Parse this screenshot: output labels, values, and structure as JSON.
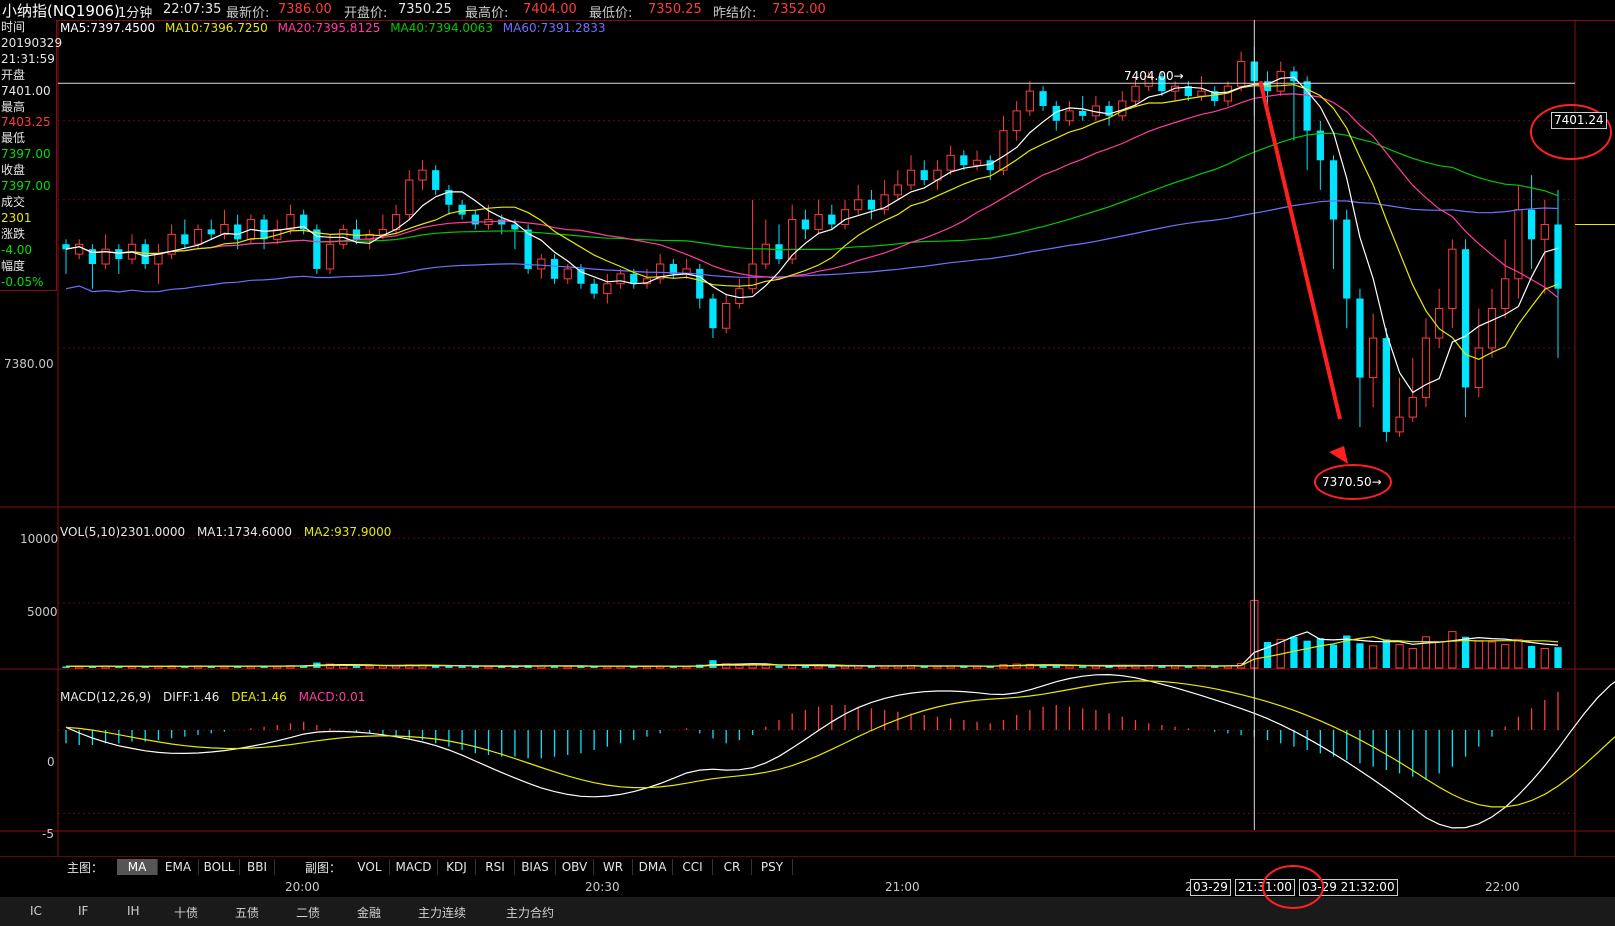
{
  "topbar": {
    "title": "小纳指(NQ1906)",
    "period": "1分钟",
    "time": "22:07:35",
    "latest_label": "最新价:",
    "latest_value": "7386.00",
    "open_label": "开盘价:",
    "open_value": "7350.25",
    "high_label": "最高价:",
    "high_value": "7404.00",
    "low_label": "最低价:",
    "low_value": "7350.25",
    "prev_label": "昨结价:",
    "prev_value": "7352.00"
  },
  "info_panel": {
    "time_label": "时间",
    "date": "20190329",
    "time": "21:31:59",
    "open_label": "开盘",
    "open": "7401.00",
    "high_label": "最高",
    "high": "7403.25",
    "low_label": "最低",
    "low": "7397.00",
    "close_label": "收盘",
    "close": "7397.00",
    "volume_label": "成交",
    "volume": "2301",
    "change_label": "涨跌",
    "change": "-4.00",
    "amplitude_label": "幅度",
    "amplitude": "-0.05%"
  },
  "ma_legend": {
    "ma5": "MA5:7397.4500",
    "ma10": "MA10:7396.7250",
    "ma20": "MA20:7395.8125",
    "ma40": "MA40:7394.0063",
    "ma60": "MA60:7391.2833"
  },
  "vol_legend": {
    "vol": "VOL(5,10)2301.0000",
    "ma1": "MA1:1734.6000",
    "ma2": "MA2:937.9000"
  },
  "macd_legend": {
    "macd": "MACD(12,26,9)",
    "diff": "DIFF:1.46",
    "dea": "DEA:1.46",
    "macd_val": "MACD:0.01"
  },
  "annotations": {
    "high_marker": "7404.00",
    "low_marker": "7370.50",
    "cursor_price": "7401.24",
    "cursor_time_left": "03-29",
    "cursor_time_mid": "21:31:00",
    "cursor_time_right": "03-29 21:32:00"
  },
  "y_axis": {
    "price_tick": "7380.00",
    "vol_ticks": [
      "10000",
      "5000"
    ],
    "macd_ticks": [
      "0",
      "-5"
    ]
  },
  "tabs": {
    "main_label": "主图：",
    "main": [
      "MA",
      "EMA",
      "BOLL",
      "BBI"
    ],
    "sub_label": "副图：",
    "sub": [
      "VOL",
      "MACD",
      "KDJ",
      "RSI",
      "BIAS",
      "OBV",
      "WR",
      "DMA",
      "CCI",
      "CR",
      "PSY"
    ]
  },
  "time_axis": [
    "20:00",
    "20:30",
    "21:00",
    "2",
    "22:00"
  ],
  "bottom_bar": [
    "IC",
    "IF",
    "IH",
    "十债",
    "五债",
    "二债",
    "金融",
    "主力连续",
    "主力合约"
  ],
  "colors": {
    "up": "#ff3b3b",
    "down": "#00e5ff",
    "ma5": "#ffffff",
    "ma10": "#e8e800",
    "ma20": "#ff3ca0",
    "ma40": "#00c800",
    "ma60": "#7070ff",
    "annotation": "#ff2020"
  },
  "chart_data": {
    "type": "candlestick",
    "symbol": "小纳指(NQ1906)",
    "period": "1分钟",
    "price_ylim": [
      7364,
      7413
    ],
    "price_tick_labels": [
      "7380.00"
    ],
    "vol_ylim": [
      0,
      11000
    ],
    "macd_ylim": [
      -6,
      3
    ],
    "x_ticks": [
      "20:00",
      "20:30",
      "21:00",
      "2",
      "22:00"
    ],
    "candles": [
      [
        7390.5,
        7390.0,
        7391.0,
        7387.5
      ],
      [
        7389.5,
        7390.5,
        7391.0,
        7389.0
      ],
      [
        7390.0,
        7388.5,
        7390.5,
        7386.0
      ],
      [
        7388.5,
        7390.0,
        7391.5,
        7388.0
      ],
      [
        7390.0,
        7389.0,
        7390.5,
        7387.5
      ],
      [
        7389.0,
        7390.5,
        7391.5,
        7388.5
      ],
      [
        7390.5,
        7388.5,
        7391.0,
        7388.0
      ],
      [
        7388.5,
        7389.5,
        7390.5,
        7386.5
      ],
      [
        7389.5,
        7391.5,
        7392.5,
        7389.0
      ],
      [
        7391.5,
        7390.5,
        7393.0,
        7390.0
      ],
      [
        7390.5,
        7392.0,
        7392.5,
        7390.0
      ],
      [
        7392.0,
        7391.5,
        7393.0,
        7391.0
      ],
      [
        7391.5,
        7392.5,
        7394.0,
        7391.0
      ],
      [
        7392.5,
        7391.0,
        7393.5,
        7390.0
      ],
      [
        7391.0,
        7393.0,
        7393.5,
        7390.5
      ],
      [
        7393.0,
        7391.0,
        7393.5,
        7390.0
      ],
      [
        7391.0,
        7392.0,
        7393.0,
        7390.5
      ],
      [
        7392.0,
        7393.5,
        7394.5,
        7391.5
      ],
      [
        7393.5,
        7392.0,
        7394.0,
        7391.5
      ],
      [
        7392.0,
        7388.0,
        7392.5,
        7387.5
      ],
      [
        7388.0,
        7390.5,
        7391.5,
        7387.5
      ],
      [
        7390.5,
        7392.0,
        7392.5,
        7390.0
      ],
      [
        7392.0,
        7391.0,
        7393.0,
        7390.5
      ],
      [
        7391.0,
        7391.5,
        7392.0,
        7390.0
      ],
      [
        7391.5,
        7392.0,
        7393.5,
        7391.0
      ],
      [
        7392.0,
        7393.5,
        7394.5,
        7391.5
      ],
      [
        7393.5,
        7397.0,
        7398.0,
        7393.0
      ],
      [
        7397.0,
        7398.0,
        7399.0,
        7396.0
      ],
      [
        7398.0,
        7396.0,
        7398.5,
        7395.5
      ],
      [
        7396.0,
        7394.5,
        7396.5,
        7393.5
      ],
      [
        7394.5,
        7393.5,
        7395.0,
        7393.0
      ],
      [
        7393.5,
        7392.5,
        7394.0,
        7392.0
      ],
      [
        7392.5,
        7393.0,
        7394.5,
        7392.0
      ],
      [
        7393.0,
        7392.5,
        7393.5,
        7391.5
      ],
      [
        7392.5,
        7392.0,
        7393.0,
        7390.0
      ],
      [
        7392.0,
        7388.0,
        7392.5,
        7387.5
      ],
      [
        7388.0,
        7389.0,
        7389.5,
        7387.0
      ],
      [
        7389.0,
        7387.0,
        7389.5,
        7386.5
      ],
      [
        7387.0,
        7388.0,
        7388.5,
        7386.5
      ],
      [
        7388.0,
        7386.5,
        7388.5,
        7386.0
      ],
      [
        7386.5,
        7385.5,
        7387.0,
        7385.0
      ],
      [
        7385.5,
        7386.5,
        7387.5,
        7384.5
      ],
      [
        7386.5,
        7387.5,
        7388.0,
        7386.0
      ],
      [
        7387.5,
        7386.5,
        7388.0,
        7386.0
      ],
      [
        7386.5,
        7387.0,
        7388.0,
        7386.0
      ],
      [
        7387.0,
        7388.5,
        7389.5,
        7386.5
      ],
      [
        7388.5,
        7387.5,
        7389.0,
        7387.0
      ],
      [
        7387.5,
        7388.0,
        7389.0,
        7387.0
      ],
      [
        7388.0,
        7385.0,
        7388.5,
        7384.0
      ],
      [
        7385.0,
        7382.0,
        7385.5,
        7381.0
      ],
      [
        7382.0,
        7384.5,
        7385.5,
        7381.5
      ],
      [
        7384.5,
        7386.0,
        7387.0,
        7384.0
      ],
      [
        7386.0,
        7388.5,
        7395.0,
        7385.5
      ],
      [
        7388.5,
        7390.5,
        7393.0,
        7388.0
      ],
      [
        7390.5,
        7389.0,
        7392.5,
        7388.5
      ],
      [
        7389.0,
        7393.0,
        7394.5,
        7388.5
      ],
      [
        7393.0,
        7392.0,
        7394.0,
        7391.0
      ],
      [
        7392.0,
        7393.5,
        7395.0,
        7391.5
      ],
      [
        7393.5,
        7392.5,
        7394.5,
        7392.0
      ],
      [
        7392.5,
        7394.0,
        7395.0,
        7392.0
      ],
      [
        7394.0,
        7395.0,
        7396.5,
        7393.5
      ],
      [
        7395.0,
        7394.0,
        7396.0,
        7393.0
      ],
      [
        7394.0,
        7395.5,
        7397.0,
        7393.5
      ],
      [
        7395.5,
        7396.5,
        7398.0,
        7395.0
      ],
      [
        7396.5,
        7398.0,
        7399.5,
        7396.0
      ],
      [
        7398.0,
        7397.0,
        7399.0,
        7396.5
      ],
      [
        7397.0,
        7398.0,
        7399.0,
        7396.0
      ],
      [
        7398.0,
        7399.5,
        7400.5,
        7397.5
      ],
      [
        7399.5,
        7398.5,
        7400.0,
        7398.0
      ],
      [
        7398.5,
        7399.0,
        7400.0,
        7398.0
      ],
      [
        7399.0,
        7398.0,
        7399.5,
        7397.0
      ],
      [
        7398.0,
        7402.0,
        7403.5,
        7397.5
      ],
      [
        7402.0,
        7404.0,
        7405.0,
        7401.0
      ],
      [
        7404.0,
        7406.0,
        7407.0,
        7403.5
      ],
      [
        7406.0,
        7404.5,
        7406.5,
        7404.0
      ],
      [
        7404.5,
        7403.0,
        7405.0,
        7402.0
      ],
      [
        7403.0,
        7404.0,
        7405.0,
        7402.5
      ],
      [
        7404.0,
        7403.5,
        7405.5,
        7403.0
      ],
      [
        7403.5,
        7404.5,
        7405.5,
        7403.0
      ],
      [
        7404.5,
        7403.5,
        7405.0,
        7402.5
      ],
      [
        7403.5,
        7405.0,
        7406.0,
        7403.0
      ],
      [
        7405.0,
        7406.5,
        7407.5,
        7404.5
      ],
      [
        7406.5,
        7407.5,
        7408.0,
        7406.0
      ],
      [
        7407.5,
        7406.0,
        7408.0,
        7405.5
      ],
      [
        7406.0,
        7406.5,
        7407.0,
        7405.0
      ],
      [
        7406.5,
        7405.5,
        7407.0,
        7405.0
      ],
      [
        7405.5,
        7406.0,
        7407.5,
        7405.0
      ],
      [
        7406.0,
        7405.0,
        7406.5,
        7404.5
      ],
      [
        7405.0,
        7406.5,
        7407.0,
        7404.5
      ],
      [
        7406.5,
        7409.0,
        7410.0,
        7406.0
      ],
      [
        7409.0,
        7407.0,
        7410.5,
        7403.5
      ],
      [
        7407.0,
        7406.0,
        7408.0,
        7404.5
      ],
      [
        7406.0,
        7408.0,
        7409.0,
        7405.5
      ],
      [
        7408.0,
        7407.0,
        7408.5,
        7401.0
      ],
      [
        7407.0,
        7402.0,
        7407.5,
        7398.0
      ],
      [
        7402.0,
        7399.0,
        7403.0,
        7396.0
      ],
      [
        7399.0,
        7393.0,
        7399.5,
        7388.0
      ],
      [
        7393.0,
        7385.0,
        7394.0,
        7382.0
      ],
      [
        7385.0,
        7377.0,
        7386.0,
        7372.0
      ],
      [
        7377.0,
        7381.0,
        7383.5,
        7374.0
      ],
      [
        7381.0,
        7371.5,
        7382.0,
        7370.5
      ],
      [
        7371.5,
        7373.0,
        7377.0,
        7371.0
      ],
      [
        7373.0,
        7375.0,
        7379.0,
        7372.5
      ],
      [
        7375.0,
        7381.0,
        7383.0,
        7374.0
      ],
      [
        7381.0,
        7384.0,
        7386.0,
        7380.0
      ],
      [
        7384.0,
        7390.0,
        7391.0,
        7382.0
      ],
      [
        7390.0,
        7376.0,
        7391.0,
        7373.0
      ],
      [
        7376.0,
        7380.0,
        7384.0,
        7375.0
      ],
      [
        7380.0,
        7384.0,
        7386.0,
        7379.0
      ],
      [
        7384.0,
        7387.0,
        7391.0,
        7383.0
      ],
      [
        7387.0,
        7394.0,
        7396.5,
        7385.0
      ],
      [
        7394.0,
        7391.0,
        7397.5,
        7388.0
      ],
      [
        7391.0,
        7392.5,
        7395.0,
        7385.5
      ],
      [
        7392.5,
        7386.0,
        7396.0,
        7379.0
      ]
    ],
    "volumes": [
      [
        120,
        "d"
      ],
      [
        150,
        "u"
      ],
      [
        130,
        "d"
      ],
      [
        140,
        "u"
      ],
      [
        110,
        "d"
      ],
      [
        120,
        "u"
      ],
      [
        100,
        "d"
      ],
      [
        130,
        "u"
      ],
      [
        160,
        "u"
      ],
      [
        140,
        "d"
      ],
      [
        150,
        "u"
      ],
      [
        120,
        "d"
      ],
      [
        140,
        "u"
      ],
      [
        160,
        "d"
      ],
      [
        130,
        "u"
      ],
      [
        150,
        "d"
      ],
      [
        130,
        "u"
      ],
      [
        180,
        "u"
      ],
      [
        200,
        "d"
      ],
      [
        420,
        "d"
      ],
      [
        300,
        "u"
      ],
      [
        200,
        "u"
      ],
      [
        160,
        "d"
      ],
      [
        140,
        "u"
      ],
      [
        160,
        "u"
      ],
      [
        180,
        "u"
      ],
      [
        240,
        "u"
      ],
      [
        200,
        "u"
      ],
      [
        160,
        "d"
      ],
      [
        150,
        "d"
      ],
      [
        130,
        "d"
      ],
      [
        140,
        "d"
      ],
      [
        130,
        "u"
      ],
      [
        120,
        "d"
      ],
      [
        130,
        "d"
      ],
      [
        220,
        "d"
      ],
      [
        160,
        "u"
      ],
      [
        170,
        "d"
      ],
      [
        130,
        "u"
      ],
      [
        140,
        "d"
      ],
      [
        120,
        "d"
      ],
      [
        140,
        "u"
      ],
      [
        150,
        "u"
      ],
      [
        120,
        "d"
      ],
      [
        130,
        "u"
      ],
      [
        150,
        "u"
      ],
      [
        130,
        "d"
      ],
      [
        120,
        "u"
      ],
      [
        260,
        "d"
      ],
      [
        600,
        "d"
      ],
      [
        320,
        "u"
      ],
      [
        200,
        "u"
      ],
      [
        260,
        "u"
      ],
      [
        200,
        "u"
      ],
      [
        180,
        "d"
      ],
      [
        200,
        "u"
      ],
      [
        160,
        "d"
      ],
      [
        160,
        "u"
      ],
      [
        150,
        "d"
      ],
      [
        150,
        "u"
      ],
      [
        170,
        "u"
      ],
      [
        140,
        "d"
      ],
      [
        150,
        "u"
      ],
      [
        160,
        "u"
      ],
      [
        180,
        "u"
      ],
      [
        150,
        "d"
      ],
      [
        130,
        "u"
      ],
      [
        160,
        "u"
      ],
      [
        130,
        "d"
      ],
      [
        140,
        "u"
      ],
      [
        140,
        "d"
      ],
      [
        260,
        "u"
      ],
      [
        300,
        "u"
      ],
      [
        280,
        "u"
      ],
      [
        200,
        "d"
      ],
      [
        180,
        "d"
      ],
      [
        160,
        "u"
      ],
      [
        150,
        "d"
      ],
      [
        150,
        "u"
      ],
      [
        140,
        "d"
      ],
      [
        170,
        "u"
      ],
      [
        200,
        "u"
      ],
      [
        200,
        "u"
      ],
      [
        160,
        "d"
      ],
      [
        150,
        "u"
      ],
      [
        140,
        "d"
      ],
      [
        160,
        "u"
      ],
      [
        140,
        "d"
      ],
      [
        160,
        "u"
      ],
      [
        350,
        "u"
      ],
      [
        5200,
        "u"
      ],
      [
        2000,
        "d"
      ],
      [
        2200,
        "u"
      ],
      [
        2400,
        "d"
      ],
      [
        2100,
        "d"
      ],
      [
        2300,
        "d"
      ],
      [
        1800,
        "d"
      ],
      [
        2500,
        "d"
      ],
      [
        1900,
        "d"
      ],
      [
        1700,
        "u"
      ],
      [
        2200,
        "d"
      ],
      [
        1800,
        "u"
      ],
      [
        1500,
        "u"
      ],
      [
        2400,
        "u"
      ],
      [
        2000,
        "u"
      ],
      [
        2800,
        "u"
      ],
      [
        2400,
        "d"
      ],
      [
        2100,
        "u"
      ],
      [
        2000,
        "u"
      ],
      [
        1800,
        "u"
      ],
      [
        2200,
        "u"
      ],
      [
        1700,
        "d"
      ],
      [
        1500,
        "u"
      ],
      [
        1600,
        "d"
      ]
    ],
    "macd_hist": [
      -0.8,
      -0.9,
      -0.9,
      -0.8,
      -0.8,
      -0.7,
      -0.7,
      -0.6,
      -0.5,
      -0.4,
      -0.3,
      -0.2,
      -0.1,
      0.0,
      0.1,
      0.2,
      0.3,
      0.4,
      0.5,
      0.3,
      0.1,
      0.0,
      -0.1,
      -0.2,
      -0.3,
      -0.4,
      -0.5,
      -0.6,
      -0.8,
      -1.0,
      -1.2,
      -1.4,
      -1.5,
      -1.6,
      -1.6,
      -1.7,
      -1.7,
      -1.6,
      -1.5,
      -1.4,
      -1.2,
      -1.0,
      -0.8,
      -0.6,
      -0.4,
      -0.2,
      0.0,
      0.1,
      -0.2,
      -0.5,
      -0.8,
      -0.6,
      -0.3,
      0.2,
      0.6,
      1.0,
      1.2,
      1.4,
      1.5,
      1.5,
      1.4,
      1.3,
      1.2,
      1.1,
      1.0,
      0.9,
      0.8,
      0.7,
      0.6,
      0.5,
      0.4,
      0.6,
      0.9,
      1.2,
      1.4,
      1.5,
      1.4,
      1.3,
      1.2,
      1.0,
      0.8,
      0.6,
      0.4,
      0.3,
      0.2,
      0.1,
      0.0,
      -0.1,
      -0.2,
      -0.3,
      -0.4,
      -0.6,
      -0.8,
      -1.0,
      -1.2,
      -1.4,
      -1.6,
      -1.8,
      -2.0,
      -2.2,
      -2.4,
      -2.6,
      -2.8,
      -3.0,
      -2.6,
      -2.2,
      -1.6,
      -1.0,
      -0.4,
      0.2,
      0.8,
      1.3,
      1.8,
      2.3,
      2.8,
      3.0,
      3.0,
      2.8,
      2.4,
      2.0
    ]
  }
}
